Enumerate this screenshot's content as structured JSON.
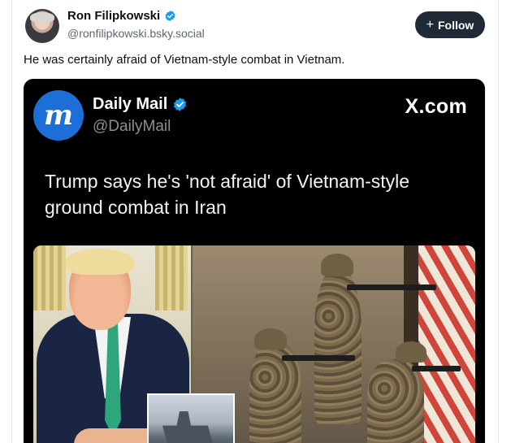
{
  "post": {
    "author_name": "Ron Filipkowski",
    "author_handle": "@ronfilipkowski.bsky.social",
    "follow_label": "Follow",
    "follow_plus": "+",
    "text": "He was certainly afraid of Vietnam-style combat in Vietnam."
  },
  "embed": {
    "logo_letter": "m",
    "source_name": "Daily Mail",
    "source_handle": "@DailyMail",
    "site_label": "X.com",
    "headline": "Trump says he's 'not afraid' of Vietnam-style ground combat in Iran"
  },
  "colors": {
    "verified_blue": "#1d9bf0",
    "follow_bg": "#1f2a36",
    "embed_bg": "#000000",
    "dm_logo_blue": "#1b6fd6"
  },
  "icons": {
    "verified": "verified-check-icon",
    "plus": "plus-icon"
  }
}
